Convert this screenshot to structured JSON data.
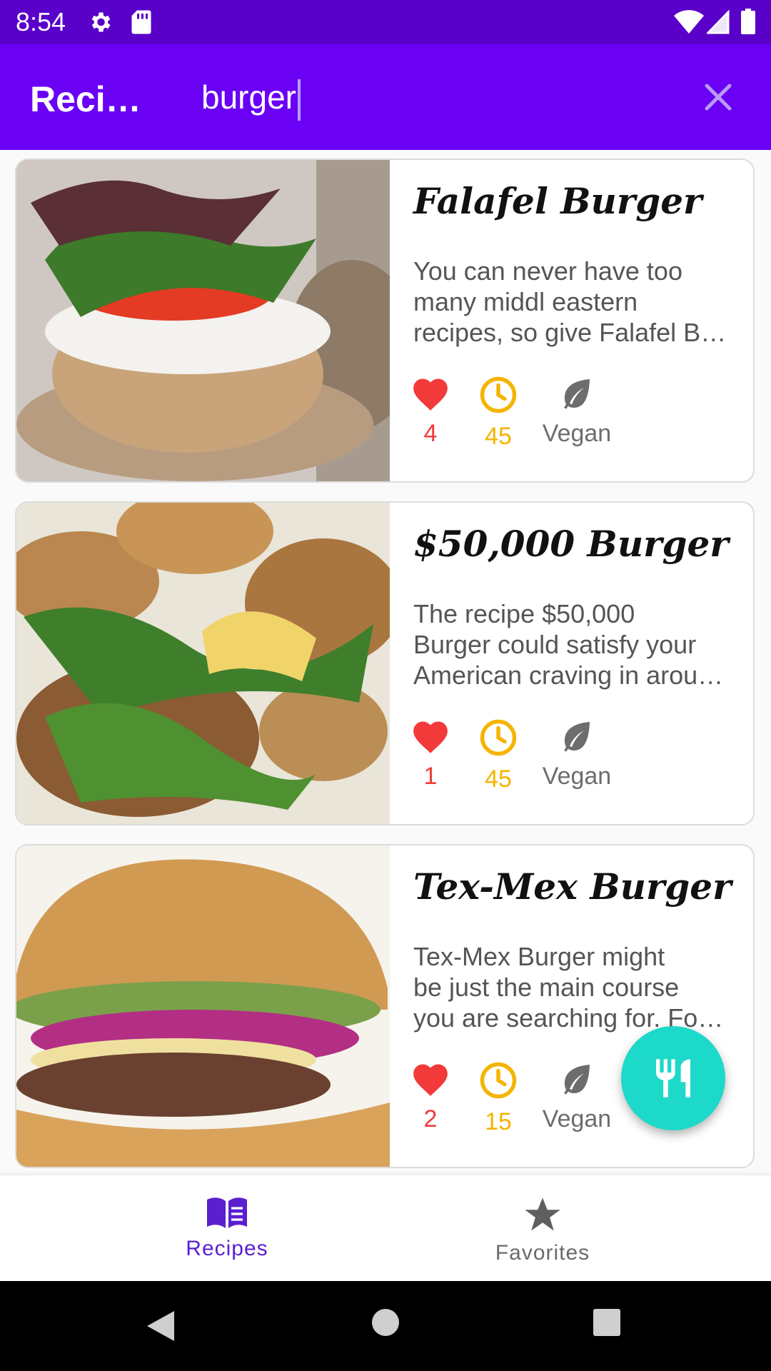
{
  "status_bar": {
    "time": "8:54"
  },
  "app_bar": {
    "title": "Recipes",
    "search_value": "burger"
  },
  "recipes": [
    {
      "title": "Falafel Burger",
      "description_lines": [
        "You can never have too",
        "many middl eastern",
        "recipes, so give Falafel B…"
      ],
      "likes": "4",
      "minutes": "45",
      "diet": "Vegan",
      "image_name": "falafel-burger-photo"
    },
    {
      "title": "$50,000 Burger",
      "description_lines": [
        "The recipe $50,000",
        "Burger could satisfy your",
        "American craving in arou…"
      ],
      "likes": "1",
      "minutes": "45",
      "diet": "Vegan",
      "image_name": "fifty-thousand-burger-photo"
    },
    {
      "title": "Tex-Mex Burger",
      "description_lines": [
        "Tex-Mex Burger might",
        "be just the main course",
        "you are searching for. For…"
      ],
      "likes": "2",
      "minutes": "15",
      "diet": "Vegan",
      "image_name": "tex-mex-burger-photo"
    }
  ],
  "bottom_nav": {
    "recipes_label": "Recipes",
    "favorites_label": "Favorites",
    "selected": "Recipes"
  },
  "colors": {
    "status_bar": "#5900c9",
    "app_bar": "#6a00f4",
    "accent_like": "#f23a3a",
    "accent_time": "#f5b400",
    "fab": "#1dd9c9",
    "nav_selected": "#5b1fd0"
  },
  "icons": {
    "like": "heart-icon",
    "time": "clock-icon",
    "diet": "leaf-icon",
    "fab": "fork-knife-icon",
    "nav_recipes": "book-icon",
    "nav_favorites": "star-icon"
  }
}
